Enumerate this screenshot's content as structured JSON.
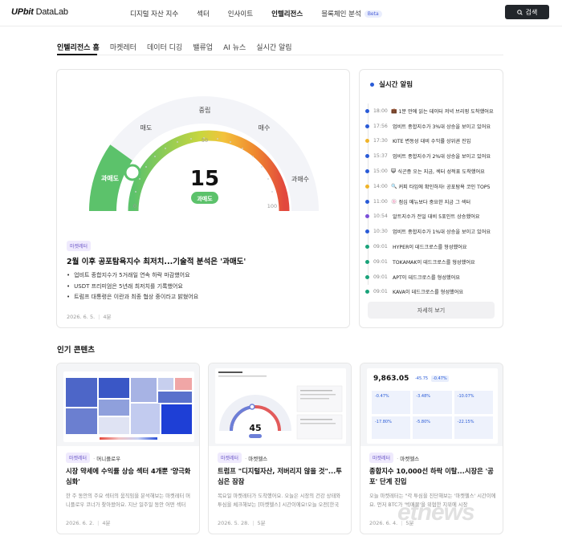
{
  "header": {
    "logo_bold": "UPbit",
    "logo_light": " DataLab",
    "nav": [
      {
        "label": "디지털 자산 지수",
        "active": false
      },
      {
        "label": "섹터",
        "active": false
      },
      {
        "label": "인사이트",
        "active": false
      },
      {
        "label": "인텔리전스",
        "active": true
      },
      {
        "label": "블록체인 분석",
        "active": false
      }
    ],
    "beta_badge": "Beta",
    "search_label": "검색"
  },
  "subnav": [
    "인텔리전스 홈",
    "마켓레터",
    "데이터 디깅",
    "밸류업",
    "AI 뉴스",
    "실시간 알림"
  ],
  "gauge": {
    "value": 15,
    "status_label": "과매도",
    "min_tick": "0",
    "mid_tick": "50",
    "max_tick": "100",
    "zones": [
      "과매도",
      "매도",
      "중립",
      "매수",
      "과매수"
    ],
    "colors": {
      "green": "#5cc26b",
      "yellow": "#f3c23c",
      "red": "#e2483d"
    }
  },
  "lead_article": {
    "tag": "마켓레터",
    "title": "2월 이후 공포탐욕지수 최저치...기술적 분석은 '과매도'",
    "bullets": [
      "업비트 종합지수가 5거래일 연속 하락 마감했어요",
      "USDT 프리미엄은 5년래 최저치를 기록했어요",
      "트럼프 대통령은 이란과 최종 협상 중이라고 밝혔어요"
    ],
    "date": "2026. 6. 5.",
    "read_time": "4분"
  },
  "alerts": {
    "title": "실시간 알림",
    "items": [
      {
        "time": "18:00",
        "emoji": "💼",
        "text": "1분 만에 읽는 데이터 저녁 브리핑 도착했어요",
        "color": "#2a5bd7"
      },
      {
        "time": "17:56",
        "emoji": "",
        "text": "업비트 종합지수가 3%대 상승을 보이고 있어요",
        "color": "#2a5bd7"
      },
      {
        "time": "17:30",
        "emoji": "",
        "text": "KITE 변동성 대비 수익률 상위권 진입",
        "color": "#f0b429"
      },
      {
        "time": "15:37",
        "emoji": "",
        "text": "업비트 종합지수가 2%대 상승을 보이고 있어요",
        "color": "#2a5bd7"
      },
      {
        "time": "15:00",
        "emoji": "😺",
        "text": "식곤증 오는 지금, 섹터 성적표 도착했어요",
        "color": "#2a5bd7"
      },
      {
        "time": "14:00",
        "emoji": "🔍",
        "text": "커피 타임에 확인하자! 공포탐욕 코인 TOP5",
        "color": "#f0b429"
      },
      {
        "time": "11:00",
        "emoji": "🍥",
        "text": "점심 메뉴보다 중요한 지금 그 섹터",
        "color": "#2a5bd7"
      },
      {
        "time": "10:54",
        "emoji": "",
        "text": "알트지수가 전일 대비 5포인트 상승했어요",
        "color": "#7a4fd8"
      },
      {
        "time": "10:30",
        "emoji": "",
        "text": "업비트 종합지수가 1%대 상승을 보이고 있어요",
        "color": "#2a5bd7"
      },
      {
        "time": "09:01",
        "emoji": "",
        "text": "HYPER이 데드크로스를 형성했어요",
        "color": "#1aa37a"
      },
      {
        "time": "09:01",
        "emoji": "",
        "text": "TOKAMAK이 데드크로스를 형성했어요",
        "color": "#1aa37a"
      },
      {
        "time": "09:01",
        "emoji": "",
        "text": "APT이 데드크로스를 형성했어요",
        "color": "#1aa37a"
      },
      {
        "time": "09:01",
        "emoji": "",
        "text": "KAVA이 데드크로스를 형성했어요",
        "color": "#1aa37a"
      }
    ],
    "more_label": "자세히 보기"
  },
  "popular": {
    "title": "인기 콘텐츠",
    "cards": [
      {
        "tags": [
          "마켓레터",
          "머니플로우"
        ],
        "title": "시장 약세에 수익률 상승 섹터 4개뿐 '양극화 심화'",
        "body": "한 주 동안의 주요 섹터의 움직임을 분석해보는 마켓레터 머니플로우 코너가 찾아왔어요. 지난 일주일 동안 어떤 섹터",
        "date": "2026. 6. 2.",
        "read_time": "4분"
      },
      {
        "tags": [
          "마켓레터",
          "마켓헬스"
        ],
        "title": "트럼프 \"디지털자산, 저버리지 않을 것\"...투심은 잠잠",
        "body": "목요일 마켓레터가 도착했어요. 오늘은 시장의 건강 상태와 투심을 체크해보는 [마켓헬스] 시간이에요!오늘 오전[한국",
        "date": "2026. 5. 28.",
        "read_time": "5분"
      },
      {
        "tags": [
          "마켓레터",
          "마켓헬스"
        ],
        "title": "종합지수 10,000선 하락 이탈...시장은 '공포' 단계 진입",
        "body": "오늘 마켓레터는 \"각 투심을 진단해보는 '마켓헬스' 시간이에요. 먼저 BTC가 '빅매물'을 위협한 지위에 시장",
        "date": "2026. 6. 4.",
        "read_time": "5분"
      }
    ],
    "thumb3": {
      "value": "9,863.05",
      "change": "-45.75",
      "pct": "-0.47%",
      "stats": [
        "-0.47%",
        "-3.48%",
        "-10.07%",
        "-17.80%",
        "-5.80%",
        "-22.15%"
      ]
    },
    "thumb2": {
      "gauge_value": "45"
    }
  },
  "watermark": "etnews"
}
